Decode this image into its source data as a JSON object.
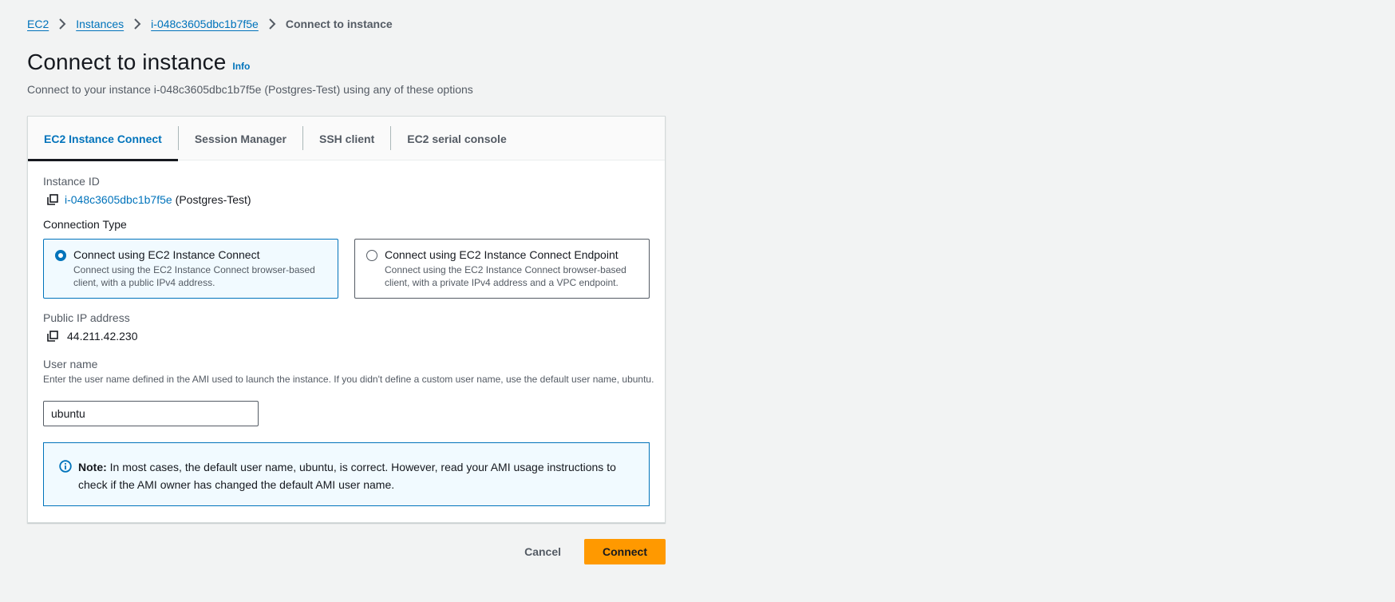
{
  "breadcrumb": {
    "items": [
      {
        "label": "EC2"
      },
      {
        "label": "Instances"
      },
      {
        "label": "i-048c3605dbc1b7f5e"
      }
    ],
    "current": "Connect to instance"
  },
  "header": {
    "title": "Connect to instance",
    "info_label": "Info",
    "description": "Connect to your instance i-048c3605dbc1b7f5e (Postgres-Test) using any of these options"
  },
  "tabs": [
    {
      "label": "EC2 Instance Connect",
      "active": true
    },
    {
      "label": "Session Manager",
      "active": false
    },
    {
      "label": "SSH client",
      "active": false
    },
    {
      "label": "EC2 serial console",
      "active": false
    }
  ],
  "instance": {
    "label": "Instance ID",
    "id": "i-048c3605dbc1b7f5e",
    "name": "(Postgres-Test)"
  },
  "connection_type": {
    "label": "Connection Type",
    "options": [
      {
        "title": "Connect using EC2 Instance Connect",
        "desc_line1": "Connect using the EC2 Instance Connect browser-based",
        "desc_line2": "client, with a public IPv4 address.",
        "selected": true
      },
      {
        "title": "Connect using EC2 Instance Connect Endpoint",
        "desc_line1": "Connect using the EC2 Instance Connect browser-based",
        "desc_line2": "client, with a private IPv4 address and a VPC endpoint.",
        "selected": false
      }
    ]
  },
  "public_ip": {
    "label": "Public IP address",
    "value": "44.211.42.230"
  },
  "username": {
    "label": "User name",
    "description": "Enter the user name defined in the AMI used to launch the instance. If you didn't define a custom user name, use the default user name, ubuntu.",
    "value": "ubuntu"
  },
  "note": {
    "bold": "Note:",
    "text": " In most cases, the default user name, ubuntu, is correct. However, read your AMI usage instructions to check if the AMI owner has changed the default AMI user name."
  },
  "actions": {
    "cancel_label": "Cancel",
    "connect_label": "Connect"
  },
  "colors": {
    "link": "#0073bb",
    "primary_button": "#ff9900",
    "background": "#f2f3f3"
  }
}
